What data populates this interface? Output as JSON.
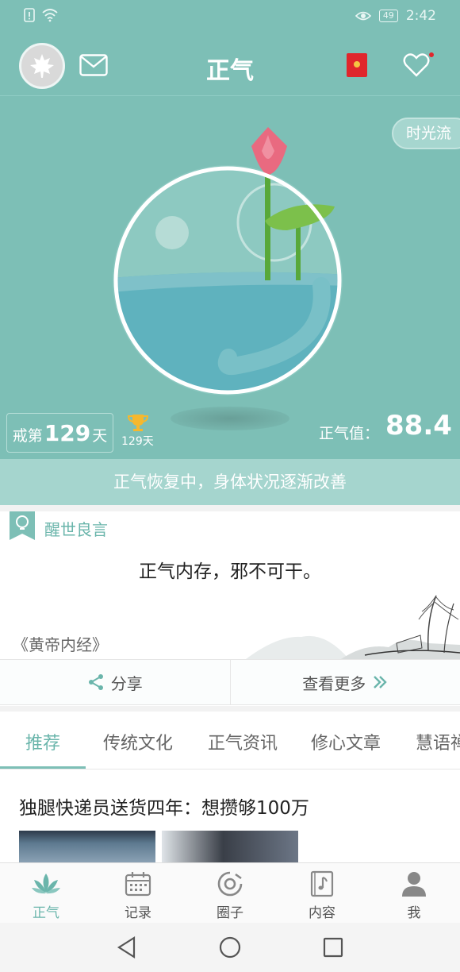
{
  "status_bar": {
    "time": "2:42",
    "battery": "49"
  },
  "header": {
    "title": "正气"
  },
  "hero": {
    "time_flow_label": "时光流",
    "days_prefix": "戒第",
    "days_count": "129",
    "days_unit": "天",
    "best_record": "129天",
    "zhengqi_label": "正气值：",
    "zhengqi_value": "88.4",
    "status_message": "正气恢复中，身体状况逐渐改善"
  },
  "quote": {
    "section_title": "醒世良言",
    "text": "正气内存，邪不可干。",
    "source": "《黄帝内经》",
    "share_label": "分享",
    "more_label": "查看更多"
  },
  "tabs": [
    "推荐",
    "传统文化",
    "正气资讯",
    "修心文章",
    "慧语禅"
  ],
  "feed": {
    "article_title": "独腿快递员送货四年：想攒够100万"
  },
  "bottom_nav": [
    {
      "label": "正气",
      "icon": "lotus-icon"
    },
    {
      "label": "记录",
      "icon": "calendar-icon"
    },
    {
      "label": "圈子",
      "icon": "circle-icon"
    },
    {
      "label": "内容",
      "icon": "music-book-icon"
    },
    {
      "label": "我",
      "icon": "person-icon"
    }
  ],
  "colors": {
    "primary": "#7dbfb6",
    "accent": "#6ab5ab",
    "water": "#5fb2be",
    "lotus": "#e96a80"
  }
}
